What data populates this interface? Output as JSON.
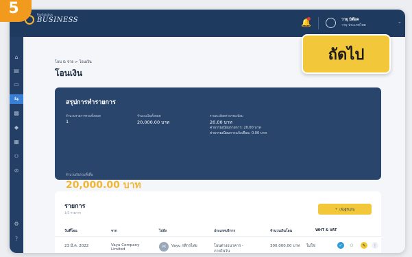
{
  "step": "5",
  "app": {
    "logo_sub": "PaySolution",
    "logo_text": "BUSINESS"
  },
  "user": {
    "name": "วายุ มิต๊อค",
    "role": "วายุ ประเภทไทย"
  },
  "breadcrumb": "โอน & จ่าย > โอนเงิน",
  "page_title": "โอนเงิน",
  "next_button": "ถัดไป",
  "summary": {
    "title": "สรุปการทำรายการ",
    "count_label": "จำนวนรายการรวมทั้งหมด",
    "count_value": "1",
    "amount_label": "จำนวนเงินทั้งหมด",
    "amount_value": "20,000.00 บาท",
    "fee_label": "รายละเอียดค่าธรรมเนียม",
    "fee_value": "20.00 บาท",
    "fee_line1": "ค่าธรรมเนียมรายการ: 20.00 บาท",
    "fee_line2": "ค่าธรรมเนียมการแจ้งเตือน: 0.00 บาท",
    "total_label": "จำนวนเงินรวมทั้งสิ้น",
    "total_value": "20,000.00 บาท"
  },
  "list": {
    "title": "รายการ",
    "subtitle": "1/5 รายการ",
    "add_button": "เพิ่มผู้รับเงิน",
    "headers": [
      "วันที่โอน",
      "จาก",
      "ไปยัง",
      "ประเภทบริการ",
      "จำนวนเงินโอน",
      "WHT & VAT"
    ],
    "row": {
      "date": "23 มี.ค. 2022",
      "from": "Vayu Company Limited",
      "avatar": "VK",
      "to": "Vayu กสิกรไทย",
      "service": "โอนต่างธนาคาร - ภายในวัน",
      "amount": "300,000.00 บาท",
      "wht": "ไม่ใช่"
    }
  }
}
